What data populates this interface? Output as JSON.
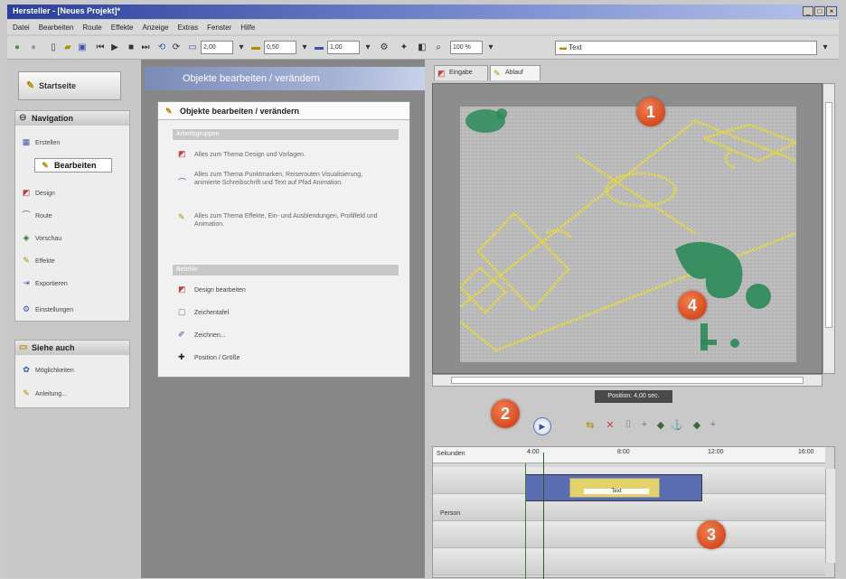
{
  "window": {
    "title": "Hersteller - [Neues Projekt]*",
    "buttons": [
      "_",
      "□",
      "×"
    ]
  },
  "menu": [
    "Datei",
    "Bearbeiten",
    "Route",
    "Effekte",
    "Anzeige",
    "Extras",
    "Fenster",
    "Hilfe"
  ],
  "toolbar": {
    "zoom1": "2,00",
    "zoom2": "0,50",
    "zoom3": "1,00",
    "speed": "100 %",
    "combo_text": "Text"
  },
  "left": {
    "start_label": "Startseite",
    "nav_title": "Navigation",
    "nav_items": [
      "Erstellen",
      "Bearbeiten",
      "Design",
      "Route",
      "Vorschau",
      "Effekte",
      "Exportieren",
      "Einstellungen"
    ],
    "see_also_title": "Siehe auch",
    "see_also_items": [
      "Möglichkeiten",
      "Anleitung..."
    ]
  },
  "middle": {
    "header": "Objekte bearbeiten / verändern",
    "box_title": "Objekte bearbeiten / verändern",
    "section1": "Arbeitsgruppen",
    "items1": [
      "Alles zum Thema Design und Vorlagen.",
      "Alles zum Thema Punktmarken, Reiserouten Visualisierung, animierte Schreibschrift und Text auf Pfad Animation.",
      "Alles zum Thema Effekte, Ein- und Ausblendungen, Profilfeld und Animation."
    ],
    "section2": "Befehle",
    "items2": [
      "Design bearbeiten",
      "Zeichentafel",
      "Zeichnen...",
      "Position / Größe"
    ]
  },
  "right": {
    "tab1": "Eingabe",
    "tab2": "Ablauf",
    "tooltip": "Position: 4,00 sec.",
    "timeline": {
      "ruler_label": "Sekunden",
      "ticks": [
        "4:00",
        "8:00",
        "12:00",
        "16:00"
      ],
      "clip_label": "Text",
      "track_name": "Person"
    }
  },
  "badges": [
    "1",
    "2",
    "3",
    "4"
  ],
  "colors": {
    "title_bar": "#2b3f9a",
    "badge": "#d84a1e",
    "field_lines": "#e8d93a",
    "clip": "#5a6db0",
    "clip_text_bg": "#e2d36a"
  }
}
